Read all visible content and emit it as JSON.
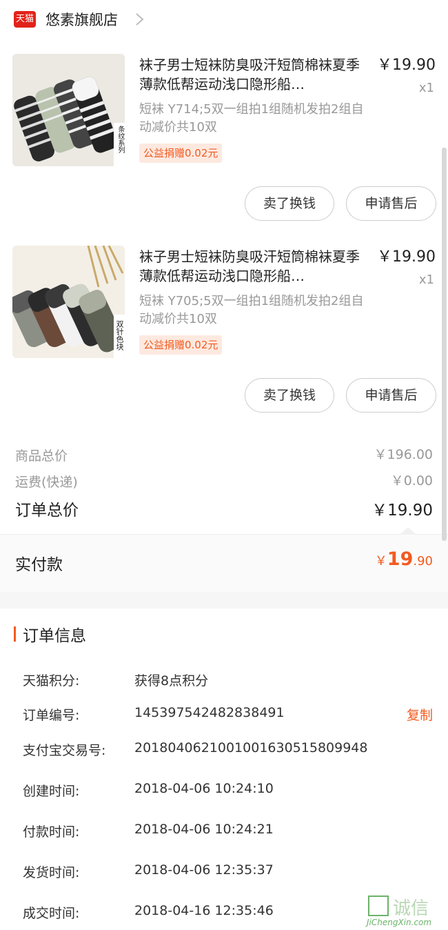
{
  "store": {
    "badge": "天猫",
    "name": "悠素旗舰店"
  },
  "items": [
    {
      "title": "袜子男士短袜防臭吸汗短筒棉袜夏季薄款低帮运动浅口隐形船…",
      "price": "￥19.90",
      "qty": "x1",
      "spec": "短袜 Y714;5双一组拍1组随机发拍2组自动减价共10双",
      "tag": "公益捐赠0.02元",
      "image_caption": "条纹系列",
      "sell_button": "卖了换钱",
      "after_sale_button": "申请售后"
    },
    {
      "title": "袜子男士短袜防臭吸汗短筒棉袜夏季薄款低帮运动浅口隐形船…",
      "price": "￥19.90",
      "qty": "x1",
      "spec": "短袜 Y705;5双一组拍1组随机发拍2组自动减价共10双",
      "tag": "公益捐赠0.02元",
      "image_caption": "双针色块",
      "sell_button": "卖了换钱",
      "after_sale_button": "申请售后"
    }
  ],
  "totals": {
    "goods_label": "商品总价",
    "goods_value": "￥196.00",
    "shipping_label": "运费(快递)",
    "shipping_value": "￥0.00",
    "order_total_label": "订单总价",
    "order_total_value": "￥19.90"
  },
  "paid": {
    "label": "实付款",
    "currency": "￥",
    "integer": "19",
    "decimal": ".90"
  },
  "order_info": {
    "title": "订单信息",
    "rows": [
      {
        "label": "天猫积分:",
        "value": "获得8点积分"
      },
      {
        "label": "订单编号:",
        "value": "145397542482838491"
      },
      {
        "label": "支付宝交易号:",
        "value": "2018040621001001630515809948"
      },
      {
        "label": "创建时间:",
        "value": "2018-04-06 10:24:10"
      },
      {
        "label": "付款时间:",
        "value": "2018-04-06 10:24:21"
      },
      {
        "label": "发货时间:",
        "value": "2018-04-06 12:35:37"
      },
      {
        "label": "成交时间:",
        "value": "2018-04-16 12:35:46"
      }
    ],
    "copy_label": "复制"
  },
  "watermark": {
    "text": "诚信",
    "sub": "JiChengXin.com"
  },
  "colors": {
    "accent": "#f25a1f",
    "tmall_red": "#e2231a"
  }
}
